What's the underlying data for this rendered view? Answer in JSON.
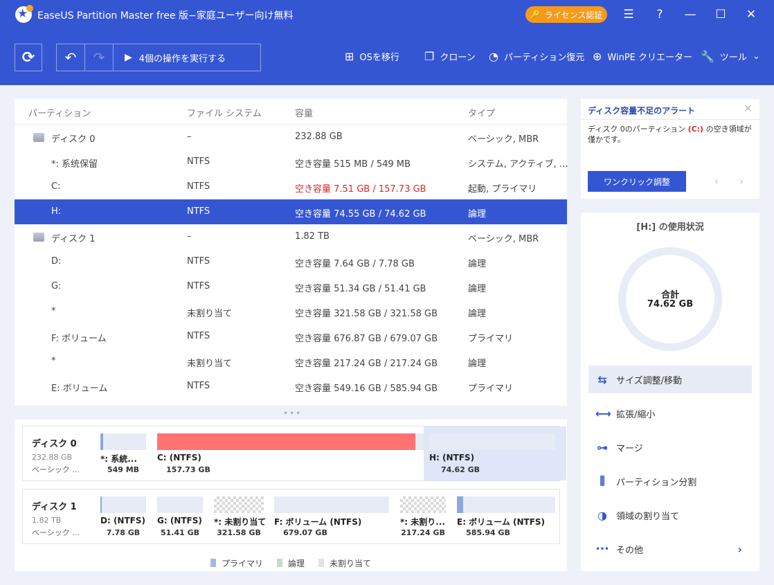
{
  "titlebar": {
    "title": "EaseUS Partition Master free 版−家庭ユーザー向け無料",
    "license_label": "ライセンス認証",
    "logo_icon": "easeus-logo-icon"
  },
  "toolbar": {
    "run_label": "4個の操作を実行する",
    "items": [
      {
        "label": "OSを移行",
        "icon": "windows-icon"
      },
      {
        "label": "クローン",
        "icon": "clone-icon"
      },
      {
        "label": "パーティション復元",
        "icon": "pie-icon"
      },
      {
        "label": "WinPE クリエーター",
        "icon": "plus-circle-icon"
      },
      {
        "label": "ツール",
        "icon": "wrench-icon"
      }
    ]
  },
  "table": {
    "headers": [
      "パーティション",
      "ファイル システム",
      "容量",
      "タイプ"
    ],
    "rows": [
      {
        "name": "ディスク 0",
        "fs": "–",
        "cap": "232.88 GB",
        "type": "ベーシック, MBR",
        "disk": true
      },
      {
        "name": "*: 系统保留",
        "fs": "NTFS",
        "cap": "空き容量 515 MB / 549 MB",
        "type": "システム, アクティブ, …"
      },
      {
        "name": "C:",
        "fs": "NTFS",
        "cap": "空き容量 7.51 GB / 157.73 GB",
        "type": "起動, プライマリ",
        "warn": true
      },
      {
        "name": "H:",
        "fs": "NTFS",
        "cap": "空き容量 74.55 GB / 74.62 GB",
        "type": "論理",
        "selected": true
      },
      {
        "name": "ディスク 1",
        "fs": "–",
        "cap": "1.82 TB",
        "type": "ベーシック, MBR",
        "disk": true
      },
      {
        "name": "D:",
        "fs": "NTFS",
        "cap": "空き容量 7.64 GB / 7.78 GB",
        "type": "論理"
      },
      {
        "name": "G:",
        "fs": "NTFS",
        "cap": "空き容量 51.34 GB / 51.41 GB",
        "type": "論理"
      },
      {
        "name": "*",
        "fs": "未割り当て",
        "cap": "空き容量 321.58 GB / 321.58 GB",
        "type": "論理"
      },
      {
        "name": "F: ボリューム",
        "fs": "NTFS",
        "cap": "空き容量 676.87 GB / 679.07 GB",
        "type": "プライマリ"
      },
      {
        "name": "*",
        "fs": "未割り当て",
        "cap": "空き容量 217.24 GB / 217.24 GB",
        "type": "論理"
      },
      {
        "name": "E: ボリューム",
        "fs": "NTFS",
        "cap": "空き容量 549.16 GB / 585.94 GB",
        "type": "プライマリ"
      }
    ]
  },
  "diskmap": {
    "disks": [
      {
        "name": "ディスク 0",
        "size": "232.88 GB",
        "type": "ベーシック ...",
        "parts": [
          {
            "label": "*: 系統...",
            "size": "549 MB",
            "used": 0.06,
            "color": "#8fa8db"
          },
          {
            "label": "C: (NTFS)",
            "size": "157.73 GB",
            "used": 0.95,
            "color": "#ff7272"
          },
          {
            "label": "H: (NTFS)",
            "size": "74.62 GB",
            "used": 0.0,
            "color": "#8fa8db",
            "selected": true
          }
        ]
      },
      {
        "name": "ディスク 1",
        "size": "1.82 TB",
        "type": "ベーシック ...",
        "parts": [
          {
            "label": "D: (NTFS)",
            "size": "7.78 GB",
            "used": 0.02,
            "color": "#8fa8db"
          },
          {
            "label": "G: (NTFS)",
            "size": "51.41 GB",
            "used": 0.0,
            "color": "#8fa8db"
          },
          {
            "label": "*: 未割り当て",
            "size": "321.58 GB",
            "unalloc": true
          },
          {
            "label": "F: ボリューム (NTFS)",
            "size": "679.07 GB",
            "used": 0.0,
            "color": "#8fa8db"
          },
          {
            "label": "*: 未割り...",
            "size": "217.24 GB",
            "unalloc": true
          },
          {
            "label": "E: ボリューム (NTFS)",
            "size": "585.94 GB",
            "used": 0.06,
            "color": "#8fa8db"
          }
        ]
      }
    ],
    "legend": [
      {
        "label": "プライマリ",
        "color": "#a8b9dd"
      },
      {
        "label": "論理",
        "color": "#c9d9c8"
      },
      {
        "label": "未割り当て",
        "color": "#e3e3e3"
      }
    ]
  },
  "alert": {
    "title": "ディスク容量不足のアラート",
    "body_pre": "ディスク 0のパーティション ",
    "body_drive": "(C:)",
    "body_post": " の空き領域が僅かです。",
    "button": "ワンクリック調整"
  },
  "usage": {
    "title": "[H:] の使用状況",
    "total_label": "合計",
    "total_value": "74.62 GB",
    "used_fraction": 0.001,
    "actions": [
      {
        "label": "サイズ調整/移動",
        "icon": "resize-icon",
        "active": true
      },
      {
        "label": "拡張/縮小",
        "icon": "extend-shrink-icon"
      },
      {
        "label": "マージ",
        "icon": "merge-icon"
      },
      {
        "label": "パーティション分割",
        "icon": "split-icon"
      },
      {
        "label": "領域の割り当て",
        "icon": "allocate-icon"
      },
      {
        "label": "その他",
        "icon": "more-icon",
        "more": true
      }
    ]
  }
}
